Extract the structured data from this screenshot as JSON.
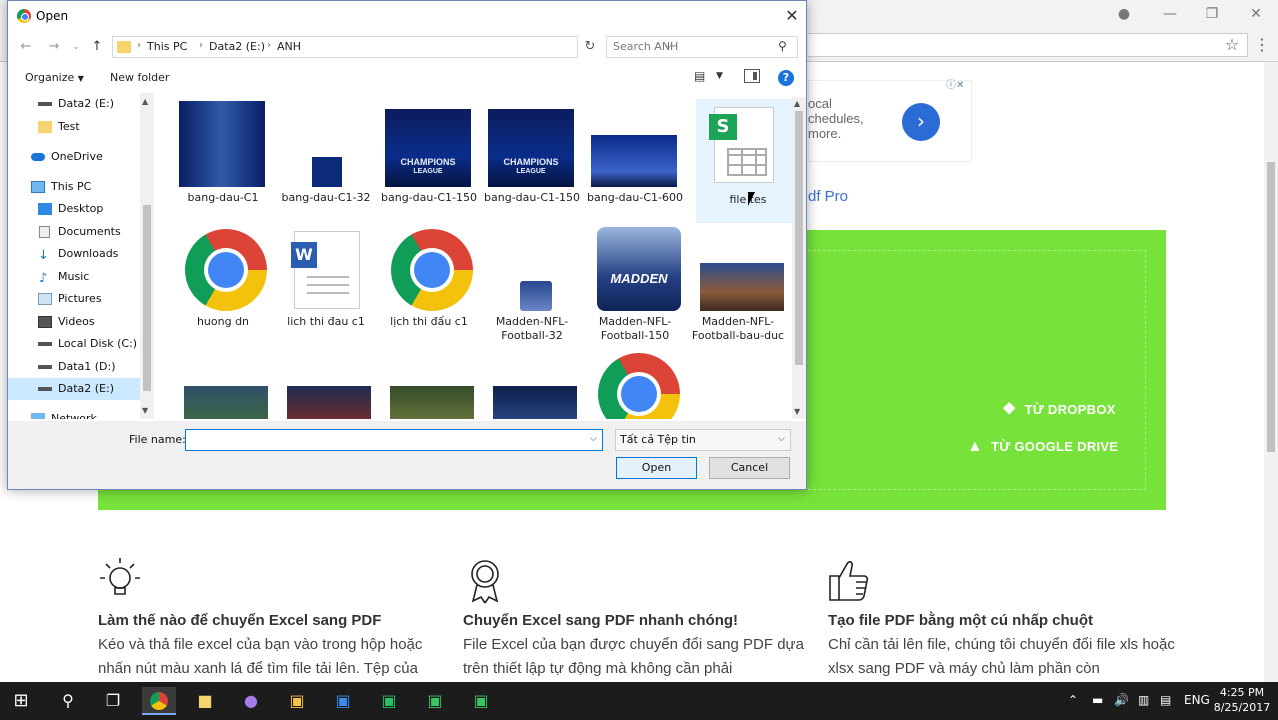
{
  "dialog": {
    "title": "Open",
    "breadcrumbs": [
      "This PC",
      "Data2 (E:)",
      "ANH"
    ],
    "search_placeholder": "Search ANH",
    "organize_label": "Organize",
    "new_folder_label": "New folder",
    "nav_items": [
      {
        "label": "Data2 (E:)",
        "icon": "drive-icon"
      },
      {
        "label": "Test",
        "icon": "folder-icon"
      },
      {
        "label": "OneDrive",
        "icon": "cloud-icon"
      },
      {
        "label": "This PC",
        "icon": "computer-icon"
      },
      {
        "label": "Desktop",
        "icon": "desktop-icon"
      },
      {
        "label": "Documents",
        "icon": "documents-icon"
      },
      {
        "label": "Downloads",
        "icon": "download-icon"
      },
      {
        "label": "Music",
        "icon": "music-icon"
      },
      {
        "label": "Pictures",
        "icon": "pictures-icon"
      },
      {
        "label": "Videos",
        "icon": "videos-icon"
      },
      {
        "label": "Local Disk (C:)",
        "icon": "drive-icon"
      },
      {
        "label": "Data1 (D:)",
        "icon": "drive-icon"
      },
      {
        "label": "Data2 (E:)",
        "icon": "drive-icon",
        "selected": true
      },
      {
        "label": "Network",
        "icon": "network-icon"
      }
    ],
    "files": [
      {
        "name": "bang-dau-C1",
        "kind": "image"
      },
      {
        "name": "bang-dau-C1-32",
        "kind": "image"
      },
      {
        "name": "bang-dau-C1-150",
        "kind": "image"
      },
      {
        "name": "bang-dau-C1-150",
        "kind": "image"
      },
      {
        "name": "bang-dau-C1-600",
        "kind": "image"
      },
      {
        "name": "file tes",
        "kind": "spreadsheet"
      },
      {
        "name": "huong dn",
        "kind": "chrome"
      },
      {
        "name": "lich thi đau c1",
        "kind": "word"
      },
      {
        "name": "lịch thi đấu c1",
        "kind": "chrome"
      },
      {
        "name": "Madden-NFL-Football-32",
        "kind": "image"
      },
      {
        "name": "Madden-NFL-Football-150",
        "kind": "image"
      },
      {
        "name": "Madden-NFL-Football-bau-duc",
        "kind": "image"
      }
    ],
    "thumb_texts": {
      "champions": "CHAMPIONS",
      "league": "LEAGUE",
      "madden": "MADDEN"
    },
    "file_name_label": "File name:",
    "file_name_value": "",
    "filter_value": "Tất cả Tệp tin",
    "open_label": "Open",
    "cancel_label": "Cancel"
  },
  "page": {
    "ad_text": "ocal\nchedules,\n more.",
    "pro_link": "df Pro",
    "dropbox_label": "TỪ DROPBOX",
    "gdrive_label": "TỪ GOOGLE DRIVE",
    "features": [
      {
        "title": "Làm thế nào để chuyển Excel sang PDF",
        "text": "Kéo và thả file excel của bạn vào trong hộp hoặc nhấn nút màu xanh lá để tìm file tải lên. Tệp của"
      },
      {
        "title": "Chuyển Excel sang PDF nhanh chóng!",
        "text": "File Excel của bạn được chuyển đổi sang PDF dựa trên thiết lập tự động mà không cần phải"
      },
      {
        "title": "Tạo file PDF bằng một cú nhấp chuột",
        "text": "Chỉ cần tải lên file, chúng tôi chuyển đổi file xls hoặc xlsx sang PDF và máy chủ làm phần còn"
      }
    ]
  },
  "taskbar": {
    "language": "ENG",
    "time": "4:25 PM",
    "date": "8/25/2017"
  },
  "colors": {
    "green_panel": "#77e23a",
    "accent_blue": "#0078d7",
    "ad_button": "#2a6bd6"
  }
}
